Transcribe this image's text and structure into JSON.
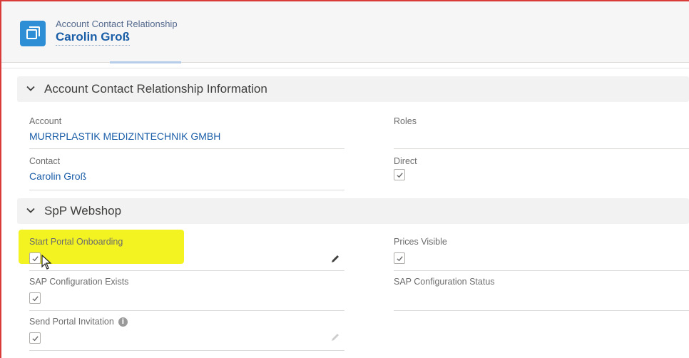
{
  "header": {
    "object_type": "Account Contact Relationship",
    "record_name": "Carolin Groß",
    "icon": "account-contact-relationship-icon"
  },
  "sections": [
    {
      "title": "Account Contact Relationship Information",
      "icon": "chevron-down-icon",
      "fields": {
        "account": {
          "label": "Account",
          "value": "MURRPLASTIK MEDIZINTECHNIK GMBH"
        },
        "roles": {
          "label": "Roles",
          "value": ""
        },
        "contact": {
          "label": "Contact",
          "value": "Carolin Groß"
        },
        "direct": {
          "label": "Direct",
          "checked": true
        }
      }
    },
    {
      "title": "SpP Webshop",
      "icon": "chevron-down-icon",
      "fields": {
        "start_portal_onboarding": {
          "label": "Start Portal Onboarding",
          "checked": true
        },
        "prices_visible": {
          "label": "Prices Visible",
          "checked": true
        },
        "sap_configuration_exists": {
          "label": "SAP Configuration Exists",
          "checked": true
        },
        "sap_configuration_status": {
          "label": "SAP Configuration Status",
          "value": ""
        },
        "send_portal_invitation": {
          "label": "Send Portal Invitation",
          "checked": true,
          "info_icon": "info-icon"
        }
      }
    }
  ],
  "colors": {
    "link": "#1b5ea8",
    "icon_bg": "#2d8ed6",
    "highlight": "#f2f20a",
    "frame": "#d93a3a"
  }
}
